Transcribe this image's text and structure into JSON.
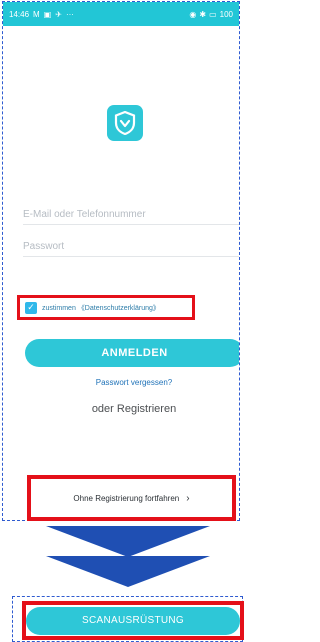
{
  "status_bar": {
    "time": "14:46",
    "indicators": "M",
    "more": "···",
    "battery": "100",
    "icons": [
      "wifi-icon",
      "bluetooth-icon",
      "battery-icon"
    ]
  },
  "login": {
    "email_placeholder": "E-Mail oder Telefonnummer",
    "password_placeholder": "Passwort",
    "consent_label": "zustimmen",
    "privacy_link": "《Datenschutzerklärung》",
    "consent_checked": true,
    "login_button": "ANMELDEN",
    "forgot_password": "Passwort vergessen?",
    "or_register": "oder Registrieren",
    "continue_without": "Ohne Registrierung fortfahren",
    "continue_chevron": "›"
  },
  "scan": {
    "button_label": "SCANAUSRÜSTUNG"
  },
  "colors": {
    "accent": "#2ec7d7",
    "highlight": "#e41019",
    "dashed_outline": "#2f5bd0",
    "arrow": "#1f4fb3"
  }
}
